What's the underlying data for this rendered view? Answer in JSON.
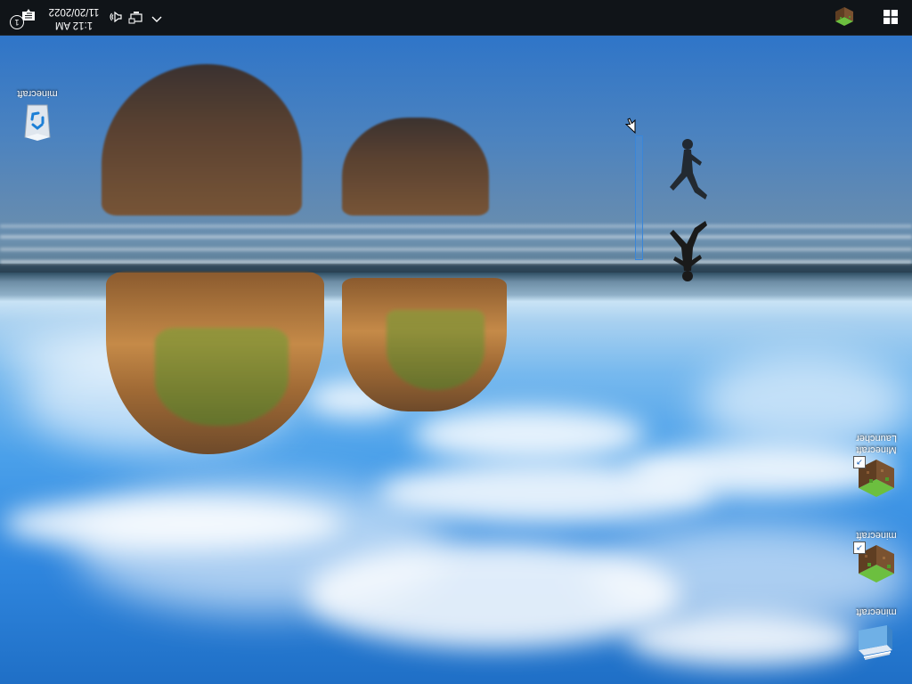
{
  "desktop": {
    "icons": [
      {
        "label": "minecraft",
        "kind": "recycle-bin"
      },
      {
        "label": "minecraft",
        "kind": "minecraft-block-shortcut"
      },
      {
        "label": "Minecraft Launcher",
        "kind": "minecraft-launcher-shortcut"
      },
      {
        "label": "minecraft",
        "kind": "minecraft-folder"
      }
    ]
  },
  "taskbar": {
    "start_icon": "windows-logo-icon",
    "pinned_app_icon": "minecraft-grass-block-icon",
    "tray": {
      "chevron_icon": "chevron-up-icon",
      "network_icon": "network-icon",
      "volume_icon": "speaker-icon",
      "notification_icon": "action-center-icon",
      "notification_count": "1"
    },
    "clock": {
      "time": "1:12 AM",
      "date": "11/20/2022"
    }
  },
  "colors": {
    "taskbar_bg": "#101418",
    "selection": "#3a86d8"
  }
}
